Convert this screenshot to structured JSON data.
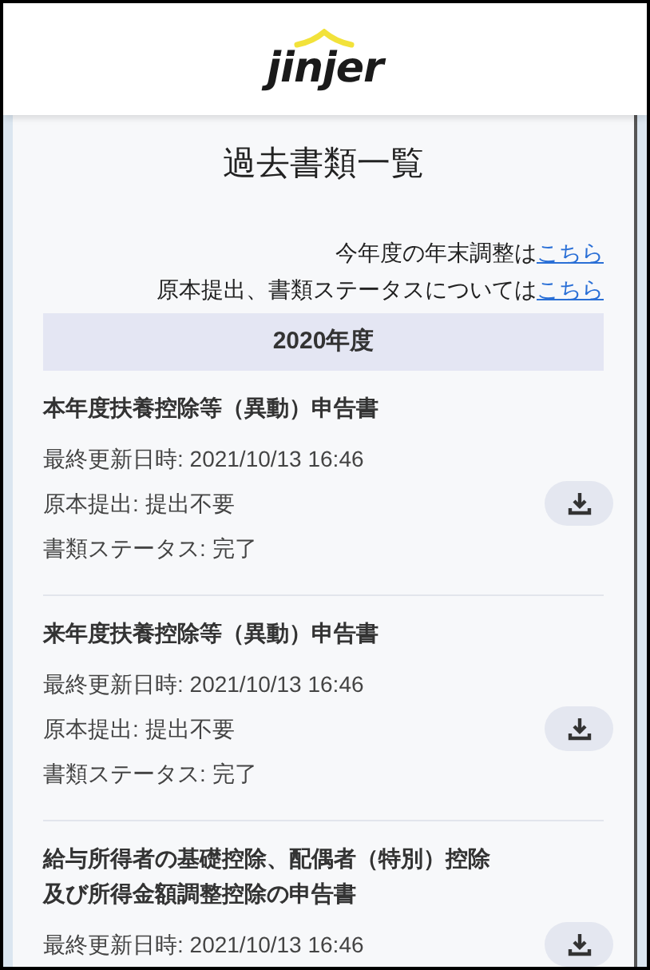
{
  "header": {
    "logo": "jinjer"
  },
  "page_title": "過去書類一覧",
  "notes": [
    {
      "text": "今年度の年末調整は",
      "link": "こちら"
    },
    {
      "text": "原本提出、書類ステータスについては",
      "link": "こちら"
    }
  ],
  "year_band": "2020年度",
  "documents": [
    {
      "title": [
        "本年度扶養控除等（異動）申告書"
      ],
      "lines": [
        "最終更新日時: 2021/10/13 16:46",
        "原本提出: 提出不要",
        "書類ステータス: 完了"
      ]
    },
    {
      "title": [
        "来年度扶養控除等（異動）申告書"
      ],
      "lines": [
        "最終更新日時: 2021/10/13 16:46",
        "原本提出: 提出不要",
        "書類ステータス: 完了"
      ]
    },
    {
      "title": [
        "給与所得者の基礎控除、配偶者（特別）控除",
        "及び所得金額調整控除の申告書"
      ],
      "lines": [
        "最終更新日時: 2021/10/13 16:46"
      ]
    }
  ]
}
